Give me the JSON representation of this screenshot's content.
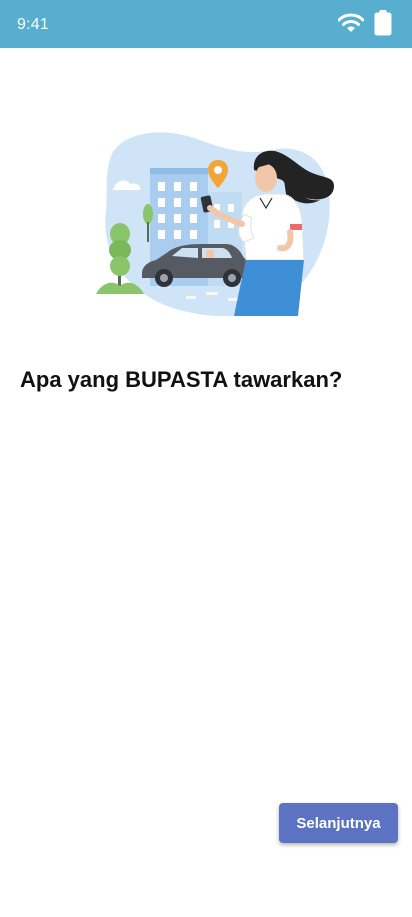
{
  "status_bar": {
    "time": "9:41",
    "background_color": "#57aecf",
    "icons": [
      "wifi-icon",
      "battery-icon"
    ]
  },
  "illustration": {
    "name": "woman-with-phone-and-car-illustration"
  },
  "main": {
    "headline": "Apa yang BUPASTA tawarkan?"
  },
  "footer": {
    "next_label": "Selanjutnya",
    "button_color": "#5b73c2"
  }
}
